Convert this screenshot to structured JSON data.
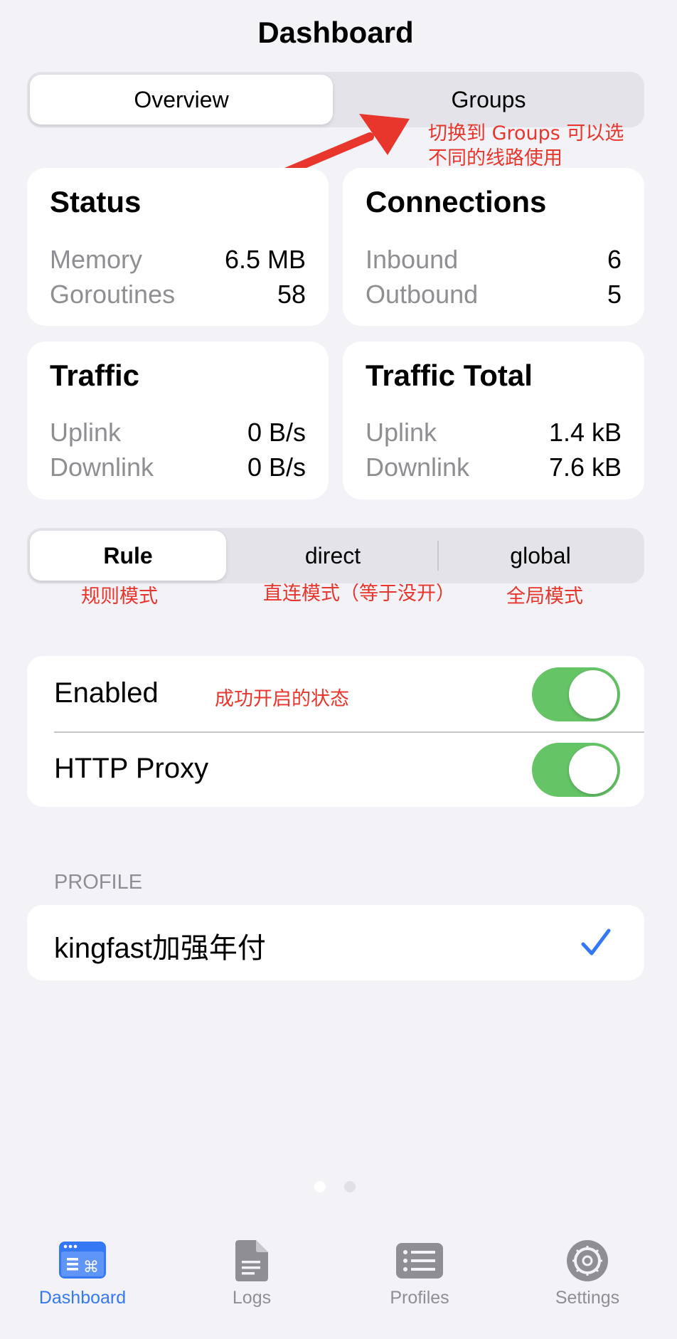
{
  "header": {
    "title": "Dashboard"
  },
  "view_tabs": [
    {
      "label": "Overview",
      "selected": true
    },
    {
      "label": "Groups",
      "selected": false
    }
  ],
  "annotations": {
    "groups_line1": "切换到 Groups 可以选",
    "groups_line2": "不同的线路使用",
    "rule": "规则模式",
    "direct": "直连模式（等于没开）",
    "global": "全局模式",
    "enabled": "成功开启的状态"
  },
  "cards": {
    "status": {
      "title": "Status",
      "rows": [
        {
          "label": "Memory",
          "value": "6.5 MB"
        },
        {
          "label": "Goroutines",
          "value": "58"
        }
      ]
    },
    "connections": {
      "title": "Connections",
      "rows": [
        {
          "label": "Inbound",
          "value": "6"
        },
        {
          "label": "Outbound",
          "value": "5"
        }
      ]
    },
    "traffic": {
      "title": "Traffic",
      "rows": [
        {
          "label": "Uplink",
          "value": "0 B/s"
        },
        {
          "label": "Downlink",
          "value": "0 B/s"
        }
      ]
    },
    "traffic_total": {
      "title": "Traffic Total",
      "rows": [
        {
          "label": "Uplink",
          "value": "1.4 kB"
        },
        {
          "label": "Downlink",
          "value": "7.6 kB"
        }
      ]
    }
  },
  "mode_tabs": [
    {
      "label": "Rule",
      "selected": true
    },
    {
      "label": "direct",
      "selected": false
    },
    {
      "label": "global",
      "selected": false
    }
  ],
  "settings": {
    "enabled": {
      "label": "Enabled",
      "on": true
    },
    "http_proxy": {
      "label": "HTTP Proxy",
      "on": true
    }
  },
  "profile": {
    "header": "PROFILE",
    "name": "kingfast加强年付",
    "selected": true
  },
  "page_indicator": {
    "count": 2,
    "current": 1
  },
  "tabbar": [
    {
      "label": "Dashboard",
      "icon": "dashboard-icon",
      "active": true
    },
    {
      "label": "Logs",
      "icon": "document-icon",
      "active": false
    },
    {
      "label": "Profiles",
      "icon": "list-icon",
      "active": false
    },
    {
      "label": "Settings",
      "icon": "gear-icon",
      "active": false
    }
  ],
  "colors": {
    "accent": "#3478f6",
    "toggle_on": "#65c466",
    "annotation": "#e8362d",
    "inactive": "#8e8e93"
  }
}
